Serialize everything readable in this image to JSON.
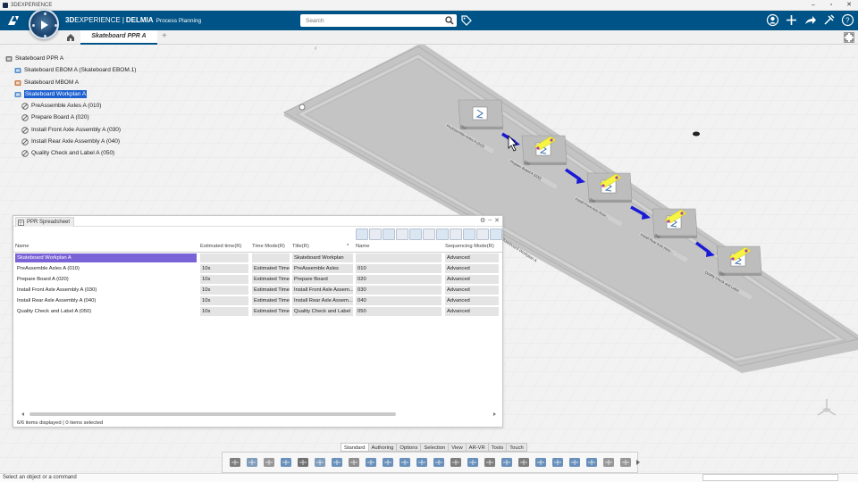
{
  "os": {
    "title": "3DEXPERIENCE",
    "controls": [
      "–",
      "▫",
      "✕"
    ]
  },
  "header": {
    "brand_prefix": "3D",
    "brand_main": "EXPERIENCE",
    "brand_sep": "|",
    "brand_product": "DELMIA",
    "app_name": "Process Planning",
    "search_placeholder": "Search"
  },
  "tabs": {
    "active": "Skateboard PPR A",
    "add": "+"
  },
  "tree": {
    "items": [
      {
        "label": "Skateboard PPR A",
        "icon": "ppr-root-icon",
        "indent": 0,
        "selected": false
      },
      {
        "label": "Skateboard EBOM A (Skateboard EBOM.1)",
        "icon": "ebom-icon",
        "indent": 1,
        "selected": false
      },
      {
        "label": "Skateboard MBOM A",
        "icon": "mbom-icon",
        "indent": 1,
        "selected": false
      },
      {
        "label": "Skateboard Workplan A",
        "icon": "workplan-icon",
        "indent": 1,
        "selected": true
      },
      {
        "label": "PreAssemble Axles A (010)",
        "icon": "operation-icon",
        "indent": 2,
        "selected": false
      },
      {
        "label": "Prepare Board A (020)",
        "icon": "operation-icon",
        "indent": 2,
        "selected": false
      },
      {
        "label": "Install Front Axle Assembly A (030)",
        "icon": "operation-icon",
        "indent": 2,
        "selected": false
      },
      {
        "label": "Install Rear Axle Assembly A (040)",
        "icon": "operation-icon",
        "indent": 2,
        "selected": false
      },
      {
        "label": "Quality Check and Label A (050)",
        "icon": "operation-icon",
        "indent": 2,
        "selected": false
      }
    ]
  },
  "spreadsheet": {
    "title": "PPR Spreadsheet",
    "columns": [
      "Name",
      "Estimated time(R)",
      "Time Mode(R)",
      "Title(R)",
      "*",
      "Name",
      "Sequencing Mode(R)"
    ],
    "rows": [
      {
        "name": "Skateboard Workplan A",
        "est": "",
        "mode": "",
        "title": "Skateboard Workplan",
        "name2": "",
        "seq": "Advanced"
      },
      {
        "name": "PreAssemble Axles A (010)",
        "est": "10s",
        "mode": "Estimated Time",
        "title": "PreAssemble Axles",
        "name2": "010",
        "seq": "Advanced"
      },
      {
        "name": "Prepare Board A (020)",
        "est": "10s",
        "mode": "Estimated Time",
        "title": "Prepare Board",
        "name2": "020",
        "seq": "Advanced"
      },
      {
        "name": "Install Front Axle Assembly A (030)",
        "est": "10s",
        "mode": "Estimated Time",
        "title": "Install Front Axle Assem...",
        "name2": "030",
        "seq": "Advanced"
      },
      {
        "name": "Install Rear Axle Assembly A (040)",
        "est": "10s",
        "mode": "Estimated Time",
        "title": "Install Rear Axle Assem...",
        "name2": "040",
        "seq": "Advanced"
      },
      {
        "name": "Quality Check and Label A (050)",
        "est": "10s",
        "mode": "Estimated Time",
        "title": "Quality Check and Label",
        "name2": "050",
        "seq": "Advanced"
      }
    ],
    "status": "6/6 items displayed | 0 items selected"
  },
  "command_tabs": [
    "Standard",
    "Authoring",
    "Options",
    "Selection",
    "View",
    "AR-VR",
    "Tools",
    "Touch"
  ],
  "command_tabs_active": "Standard",
  "status_bar": {
    "message": "Select an object or a command"
  },
  "viewport": {
    "workplan_label": "Skateboard Workplan A",
    "op_labels": [
      "PreAssemble Axles A (010)",
      "Prepare Board A (020)",
      "Install Front Axle Asse...",
      "Install Rear Axle Asse...",
      "Quality Check and Label"
    ],
    "op_numbers": [
      "010",
      "020",
      "030",
      "040",
      "050"
    ]
  },
  "colors": {
    "header": "#005386",
    "selection": "#1e60d0",
    "flow_arrow": "#1a1ad6",
    "part_yellow": "#f5f542"
  }
}
